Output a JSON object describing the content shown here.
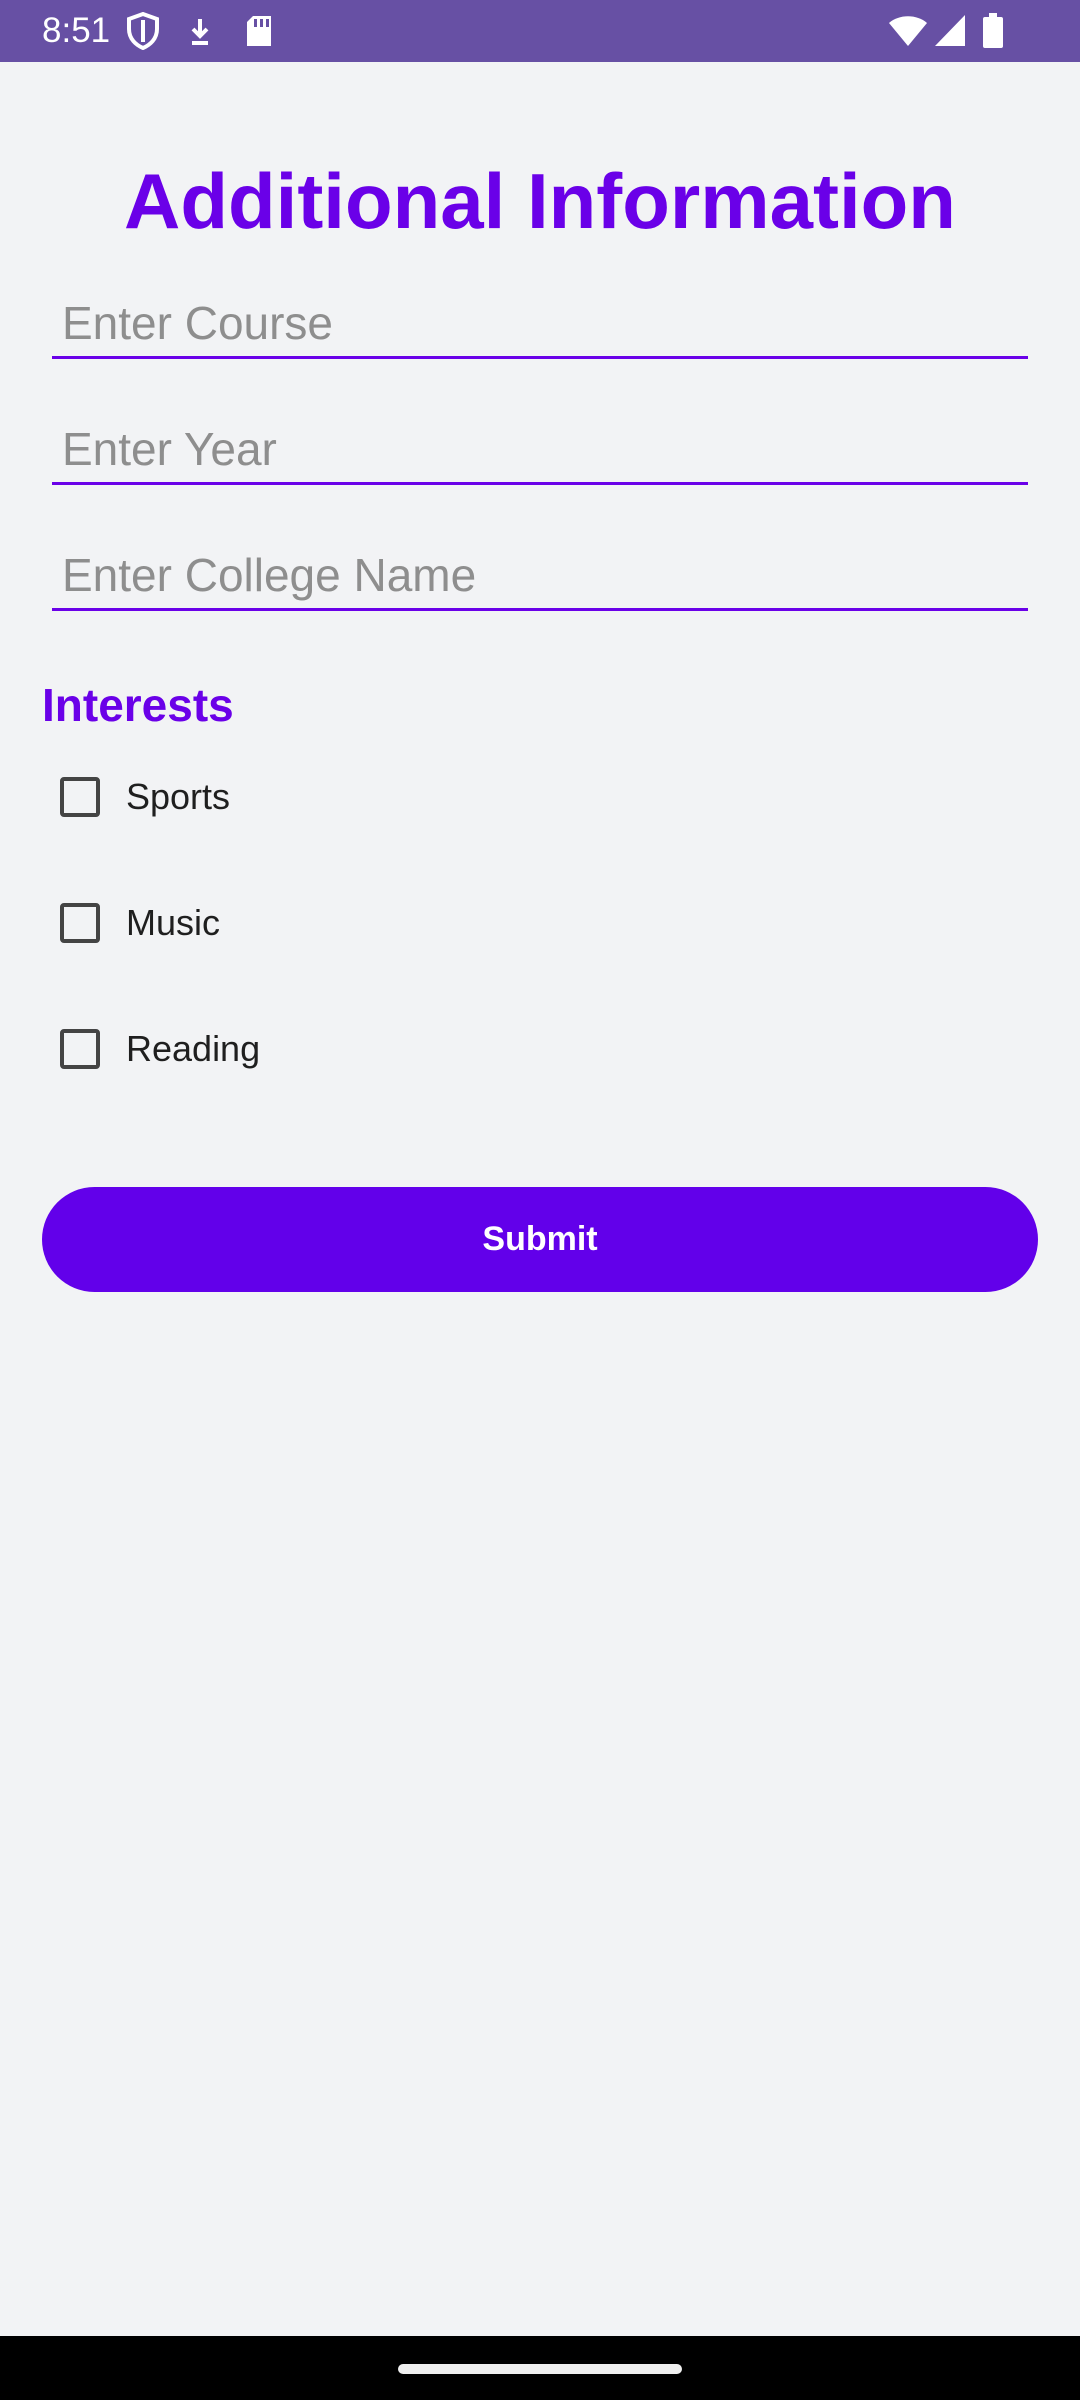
{
  "status_bar": {
    "time": "8:51",
    "icons": [
      "shield-icon",
      "download-icon",
      "sd-card-icon",
      "wifi-icon",
      "signal-icon",
      "battery-icon"
    ],
    "background": "#6750a4"
  },
  "page": {
    "title": "Additional Information",
    "accent_color": "#6a00e8"
  },
  "fields": {
    "course": {
      "placeholder": "Enter Course",
      "value": ""
    },
    "year": {
      "placeholder": "Enter Year",
      "value": ""
    },
    "college": {
      "placeholder": "Enter College Name",
      "value": ""
    }
  },
  "interests": {
    "title": "Interests",
    "options": [
      {
        "label": "Sports",
        "checked": false
      },
      {
        "label": "Music",
        "checked": false
      },
      {
        "label": "Reading",
        "checked": false
      }
    ]
  },
  "submit": {
    "label": "Submit",
    "background": "#6200ea"
  }
}
